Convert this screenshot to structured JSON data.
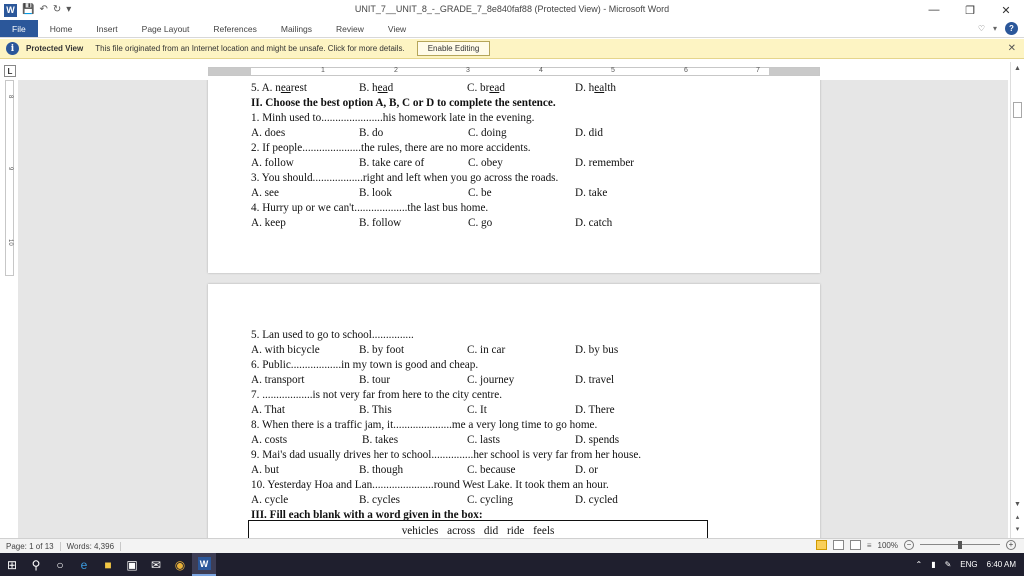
{
  "window": {
    "title": "UNIT_7__UNIT_8_-_GRADE_7_8e840faf88 (Protected View)  -  Microsoft Word",
    "app_letter": "W",
    "accent": "#2b579a"
  },
  "ribbon": {
    "tabs": [
      "File",
      "Home",
      "Insert",
      "Page Layout",
      "References",
      "Mailings",
      "Review",
      "View"
    ]
  },
  "protected_view": {
    "title": "Protected View",
    "message": "This file originated from an Internet location and might be unsafe. Click for more details.",
    "button": "Enable Editing",
    "bg": "#fdf4c3"
  },
  "ruler": {
    "corner": "L",
    "marks": [
      "1",
      "2",
      "3",
      "4",
      "5",
      "6",
      "7"
    ],
    "vmarks": [
      "8",
      "9",
      "10"
    ]
  },
  "document": {
    "page1": {
      "q5": {
        "label": "5. A. ",
        "a_pre": "n",
        "a_ul": "ea",
        "a_post": "rest",
        "b_pre": "B. h",
        "b_ul": "ea",
        "b_post": "d",
        "c_pre": "C. br",
        "c_ul": "ea",
        "c_post": "d",
        "d_pre": "D. h",
        "d_ul": "ea",
        "d_post": "lth"
      },
      "section2": "II. Choose the best option A, B, C or D to complete the sentence.",
      "questions": [
        {
          "q": "1. Minh used to......................his  homework late in the evening.",
          "a": "A. does",
          "b": "B. do",
          "c": "C. doing",
          "d": "D. did"
        },
        {
          "q": "2. If people.....................the  rules, there are no more accidents.",
          "a": "A. follow",
          "b": "B. take care of",
          "c": "C. obey",
          "d": "D. remember"
        },
        {
          "q": "3. You should..................right  and left when you go across the roads.",
          "a": "A. see",
          "b": "B. look",
          "c": "C. be",
          "d": "D. take"
        },
        {
          "q": "4. Hurry up or we can't...................the  last bus home.",
          "a": "A. keep",
          "b": "B. follow",
          "c": "C. go",
          "d": "D. catch"
        }
      ]
    },
    "page2": {
      "questions": [
        {
          "q": "5. Lan used to go to school...............",
          "a": "A. with bicycle",
          "b": "B. by foot",
          "c": "C. in car",
          "d": "D. by bus"
        },
        {
          "q": "6. Public..................in  my town is good and cheap.",
          "a": "A. transport",
          "b": "B. tour",
          "c": "C. journey",
          "d": "D. travel"
        },
        {
          "q": "7. ..................is  not very far from here to the city centre.",
          "a": "A. That",
          "b": "B. This",
          "c": "C. It",
          "d": "D. There"
        },
        {
          "q": "8. When there is a traffic jam, it.....................me  a very long time to go home.",
          "a": "A. costs",
          "b": "B. takes",
          "c": "C. lasts",
          "d": "D. spends"
        },
        {
          "q": "9. Mai's dad usually drives her to school...............her school is very far from her house.",
          "a": "A. but",
          "b": "B. though",
          "c": "C. because",
          "d": "D. or"
        },
        {
          "q": "10. Yesterday Hoa and Lan......................round  West Lake. It took them an hour.",
          "a": "A. cycle",
          "b": "B. cycles",
          "c": "C. cycling",
          "d": "D. cycled"
        }
      ],
      "section3": "III. Fill each blank with a word given in the box:",
      "box_words": "vehicles  across   did   ride   feels"
    }
  },
  "status": {
    "page": "Page: 1 of 13",
    "words": "Words: 4,396",
    "zoom": "100%",
    "zoom_minus": "−",
    "zoom_plus": "+"
  },
  "taskbar": {
    "lang": "ENG",
    "time": "6:40 AM"
  }
}
